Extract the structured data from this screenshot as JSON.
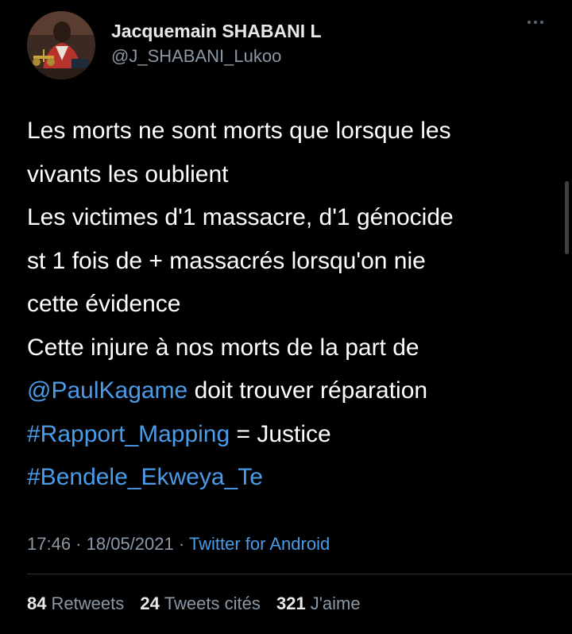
{
  "author": {
    "display_name": "Jacquemain SHABANI L",
    "handle": "@J_SHABANI_Lukoo",
    "avatar_icon": "profile-photo"
  },
  "tweet": {
    "lines": [
      [
        {
          "text": "Les morts ne sont morts que lorsque les",
          "link": false
        }
      ],
      [
        {
          "text": "vivants les oublient",
          "link": false
        }
      ],
      [
        {
          "text": "Les victimes d'1 massacre, d'1 génocide",
          "link": false
        }
      ],
      [
        {
          "text": "st 1 fois de + massacrés lorsqu'on nie",
          "link": false
        }
      ],
      [
        {
          "text": "cette évidence",
          "link": false
        }
      ],
      [
        {
          "text": "Cette injure à nos morts de la part de",
          "link": false
        }
      ],
      [
        {
          "text": "@PaulKagame",
          "link": true,
          "name": "mention-paulkagame"
        },
        {
          "text": " doit trouver réparation",
          "link": false
        }
      ],
      [
        {
          "text": "#Rapport_Mapping",
          "link": true,
          "name": "hashtag-rapport-mapping"
        },
        {
          "text": " = Justice",
          "link": false
        }
      ],
      [
        {
          "text": "#Bendele_Ekweya_Te",
          "link": true,
          "name": "hashtag-bendele-ekweya-te"
        }
      ]
    ]
  },
  "meta": {
    "time": "17:46",
    "separator": " · ",
    "date": "18/05/2021",
    "separator2": " · ",
    "source": "Twitter for Android"
  },
  "stats": {
    "retweets_count": "84",
    "retweets_label": "Retweets",
    "quotes_count": "24",
    "quotes_label": "Tweets cités",
    "likes_count": "321",
    "likes_label": "J'aime"
  },
  "colors": {
    "background": "#000000",
    "text": "#e7e9ea",
    "secondary": "#8b98a5",
    "link": "#4a9ce8"
  }
}
